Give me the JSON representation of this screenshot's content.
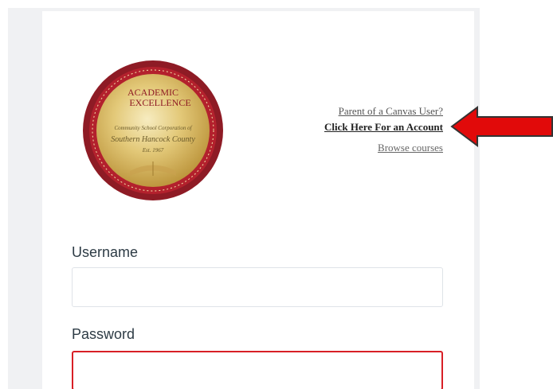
{
  "logo": {
    "line1": "ACADEMIC",
    "line2": "EXCELLENCE",
    "script1": "Community School Corporation of",
    "script2": "Southern Hancock County",
    "script3": "Est. 1967",
    "ring_color": "#a31f2a",
    "gold_color": "#d9b85a"
  },
  "links": {
    "parent_question": "Parent of a Canvas User?",
    "account_link": "Click Here For an Account",
    "browse_courses": "Browse courses"
  },
  "form": {
    "username_label": "Username",
    "username_value": "",
    "password_label": "Password",
    "password_value": ""
  },
  "colors": {
    "arrow": "#e10a0a",
    "error_border": "#d81f26",
    "label_text": "#2d3b45"
  }
}
